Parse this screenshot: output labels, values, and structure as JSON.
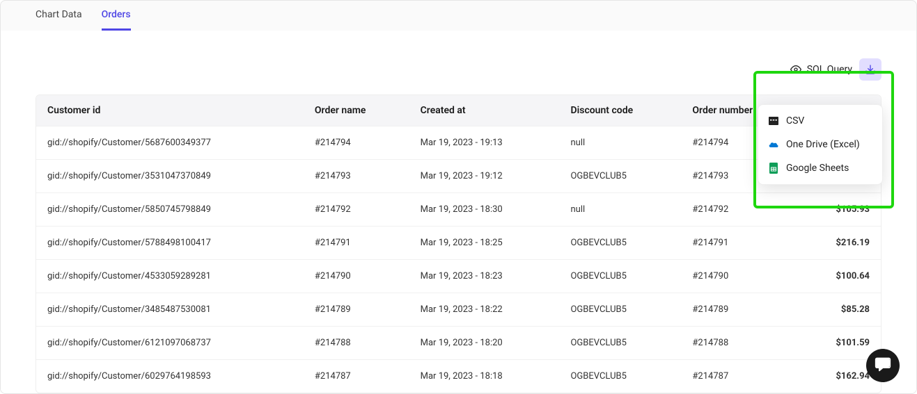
{
  "tabs": {
    "chart_data": "Chart Data",
    "orders": "Orders"
  },
  "toolbar": {
    "sql_query": "SQL Query"
  },
  "dropdown": {
    "csv": "CSV",
    "onedrive": "One Drive (Excel)",
    "gsheets": "Google Sheets"
  },
  "table": {
    "headers": {
      "customer_id": "Customer id",
      "order_name": "Order name",
      "created_at": "Created at",
      "discount_code": "Discount code",
      "order_number": "Order number",
      "amount": ""
    },
    "rows": [
      {
        "customer_id": "gid://shopify/Customer/5687600349377",
        "order_name": "#214794",
        "created_at": "Mar 19, 2023 - 19:13",
        "discount_code": "null",
        "order_number": "#214794",
        "amount": ""
      },
      {
        "customer_id": "gid://shopify/Customer/3531047370849",
        "order_name": "#214793",
        "created_at": "Mar 19, 2023 - 19:12",
        "discount_code": "OGBEVCLUB5",
        "order_number": "#214793",
        "amount": ""
      },
      {
        "customer_id": "gid://shopify/Customer/5850745798849",
        "order_name": "#214792",
        "created_at": "Mar 19, 2023 - 18:30",
        "discount_code": "null",
        "order_number": "#214792",
        "amount": "$105.93"
      },
      {
        "customer_id": "gid://shopify/Customer/5788498100417",
        "order_name": "#214791",
        "created_at": "Mar 19, 2023 - 18:25",
        "discount_code": "OGBEVCLUB5",
        "order_number": "#214791",
        "amount": "$216.19"
      },
      {
        "customer_id": "gid://shopify/Customer/4533059289281",
        "order_name": "#214790",
        "created_at": "Mar 19, 2023 - 18:23",
        "discount_code": "OGBEVCLUB5",
        "order_number": "#214790",
        "amount": "$100.64"
      },
      {
        "customer_id": "gid://shopify/Customer/3485487530081",
        "order_name": "#214789",
        "created_at": "Mar 19, 2023 - 18:22",
        "discount_code": "OGBEVCLUB5",
        "order_number": "#214789",
        "amount": "$85.28"
      },
      {
        "customer_id": "gid://shopify/Customer/6121097068737",
        "order_name": "#214788",
        "created_at": "Mar 19, 2023 - 18:20",
        "discount_code": "OGBEVCLUB5",
        "order_number": "#214788",
        "amount": "$101.59"
      },
      {
        "customer_id": "gid://shopify/Customer/6029764198593",
        "order_name": "#214787",
        "created_at": "Mar 19, 2023 - 18:18",
        "discount_code": "OGBEVCLUB5",
        "order_number": "#214787",
        "amount": "$162.94"
      }
    ]
  }
}
